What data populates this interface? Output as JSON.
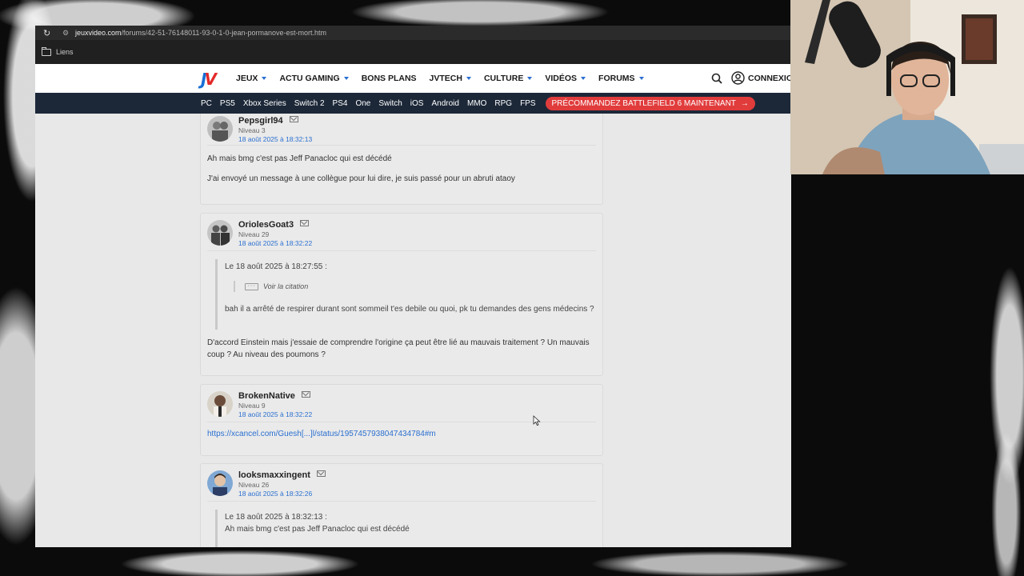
{
  "browser": {
    "url_domain": "jeuxvideo.com",
    "url_path": "/forums/42-51-76148011-93-0-1-0-jean-pormanove-est-mort.htm",
    "bookmarks_label": "Liens"
  },
  "site": {
    "menu": [
      {
        "label": "JEUX",
        "dropdown": true
      },
      {
        "label": "ACTU GAMING",
        "dropdown": true
      },
      {
        "label": "BONS PLANS",
        "dropdown": false
      },
      {
        "label": "JVTECH",
        "dropdown": true
      },
      {
        "label": "CULTURE",
        "dropdown": true
      },
      {
        "label": "VIDÉOS",
        "dropdown": true
      },
      {
        "label": "FORUMS",
        "dropdown": true
      }
    ],
    "connexion": "CONNEXION",
    "platforms": [
      "PC",
      "PS5",
      "Xbox Series",
      "Switch 2",
      "PS4",
      "One",
      "Switch",
      "iOS",
      "Android",
      "MMO",
      "RPG",
      "FPS"
    ],
    "promo": "PRÉCOMMANDEZ BATTLEFIELD 6 MAINTENANT",
    "colors": {
      "accent_blue": "#2a6fd0",
      "promo_red": "#e13c3c",
      "nav_dark": "#1c2838"
    }
  },
  "posts": [
    {
      "pseudo": "Pepsgirl94",
      "niveau": "Niveau 3",
      "date": "18 août 2025 à 18:32:13",
      "lines": [
        "Ah mais bmg c'est pas Jeff Panacloc qui est décédé",
        "J'ai envoyé un message à une collègue pour lui dire, je suis passé pour un abruti ataoy"
      ]
    },
    {
      "pseudo": "OriolesGoat3",
      "niveau": "Niveau 29",
      "date": "18 août 2025 à 18:32:22",
      "quote_header": "Le 18 août 2025 à 18:27:55 :",
      "subquote": "Voir la citation",
      "quote_text": "bah il a arrêté de respirer durant sont sommeil t'es debile ou quoi, pk tu demandes des gens médecins ?",
      "lines": [
        "D'accord Einstein mais j'essaie de comprendre l'origine ça peut être lié au mauvais traitement ? Un mauvais",
        "coup ? Au niveau des poumons ?"
      ]
    },
    {
      "pseudo": "BrokenNative",
      "niveau": "Niveau 9",
      "date": "18 août 2025 à 18:32:22",
      "link": "https://xcancel.com/Guesh[...]l/status/1957457938047434784#m"
    },
    {
      "pseudo": "looksmaxxingent",
      "niveau": "Niveau 26",
      "date": "18 août 2025 à 18:32:26",
      "quote_header": "Le 18 août 2025 à 18:32:13 :",
      "quote_text": "Ah mais bmg c'est pas Jeff Panacloc qui est décédé"
    }
  ]
}
